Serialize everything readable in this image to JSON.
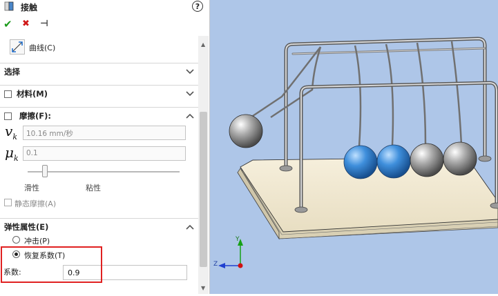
{
  "panel": {
    "title": "接触",
    "help": "?",
    "actions": {
      "ok": "✔",
      "cancel": "✖",
      "pin": "⊣"
    },
    "curve_label": "曲线(C)",
    "sections": {
      "select": "选择",
      "material": "材料(M)",
      "friction": "摩擦(F):",
      "elastic": "弹性属性(E)"
    },
    "friction": {
      "vk_symbol": "v",
      "vk_sub": "k",
      "vk_value": "10.16 mm/秒",
      "mu_symbol": "μ",
      "mu_sub": "k",
      "mu_value": "0.1",
      "slider_left": "滑性",
      "slider_right": "粘性",
      "static_label": "静态摩擦(A)"
    },
    "elastic": {
      "impact": "冲击(P)",
      "restitution": "恢复系数(T)",
      "coef_label": "系数:",
      "coef_value": "0.9"
    }
  },
  "triad": {
    "y": "Y",
    "z": "Z"
  }
}
